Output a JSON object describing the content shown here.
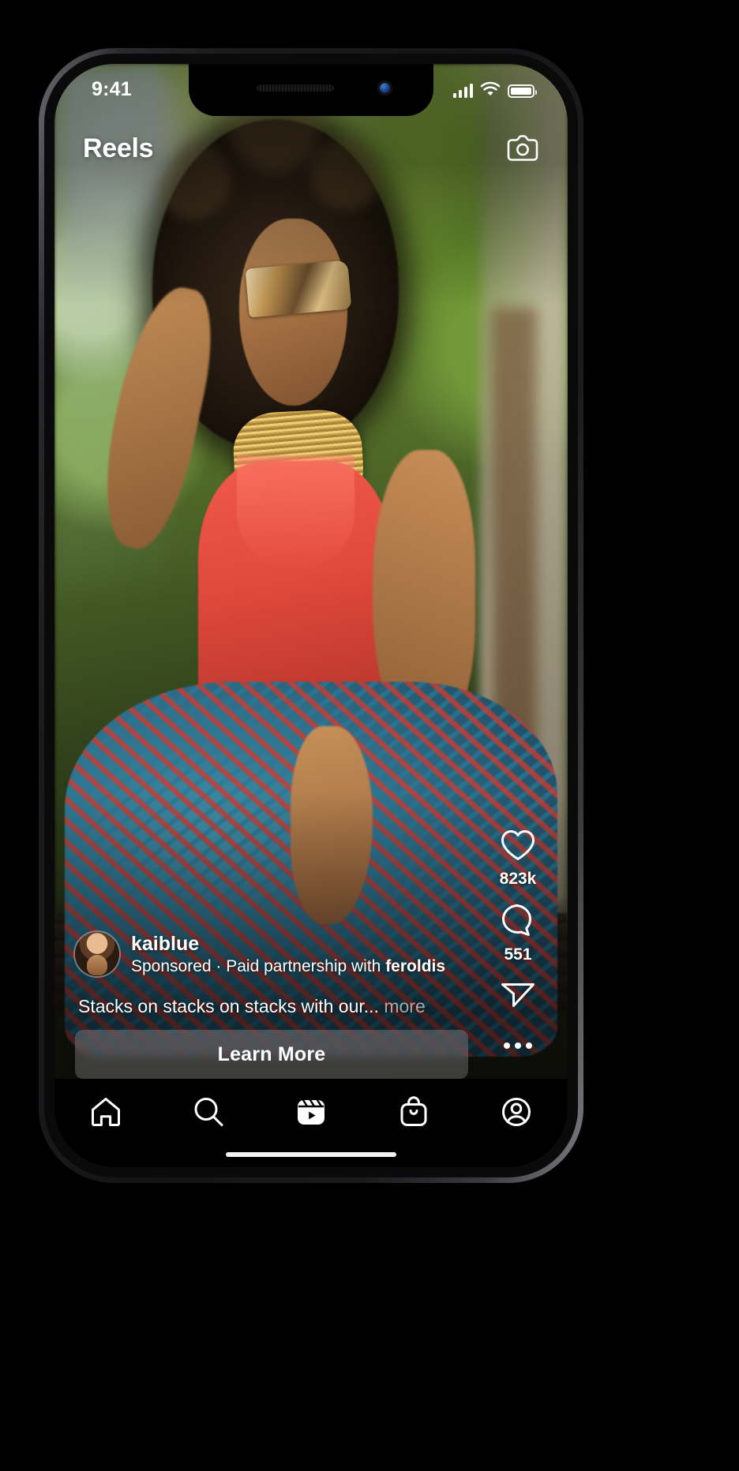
{
  "status_bar": {
    "time": "9:41",
    "signal_icon": "cellular-signal-icon",
    "wifi_icon": "wifi-icon",
    "battery_icon": "battery-full-icon"
  },
  "header": {
    "title": "Reels",
    "camera_icon": "camera-icon"
  },
  "actions": {
    "like": {
      "icon": "heart-icon",
      "count": "823k"
    },
    "comment": {
      "icon": "comment-bubble-icon",
      "count": "551"
    },
    "share": {
      "icon": "paper-plane-icon"
    },
    "more": {
      "icon": "more-options-icon"
    }
  },
  "post": {
    "username": "kaiblue",
    "sponsored_prefix": "Sponsored · Paid partnership with ",
    "partner": "feroldis",
    "caption": "Stacks on stacks on stacks with our...",
    "more_label": "more",
    "cta_label": "Learn More",
    "avatar_icon": "avatar"
  },
  "tabbar": {
    "items": [
      {
        "name": "home",
        "icon": "home-icon",
        "active": false
      },
      {
        "name": "search",
        "icon": "search-icon",
        "active": false
      },
      {
        "name": "reels",
        "icon": "reels-icon",
        "active": true
      },
      {
        "name": "shop",
        "icon": "shopping-bag-icon",
        "active": false
      },
      {
        "name": "profile",
        "icon": "profile-icon",
        "active": false
      }
    ]
  },
  "colors": {
    "background": "#000000",
    "text_primary": "#ffffff",
    "text_muted": "#a3a3a3",
    "cta_background": "rgba(255,255,255,0.20)"
  }
}
